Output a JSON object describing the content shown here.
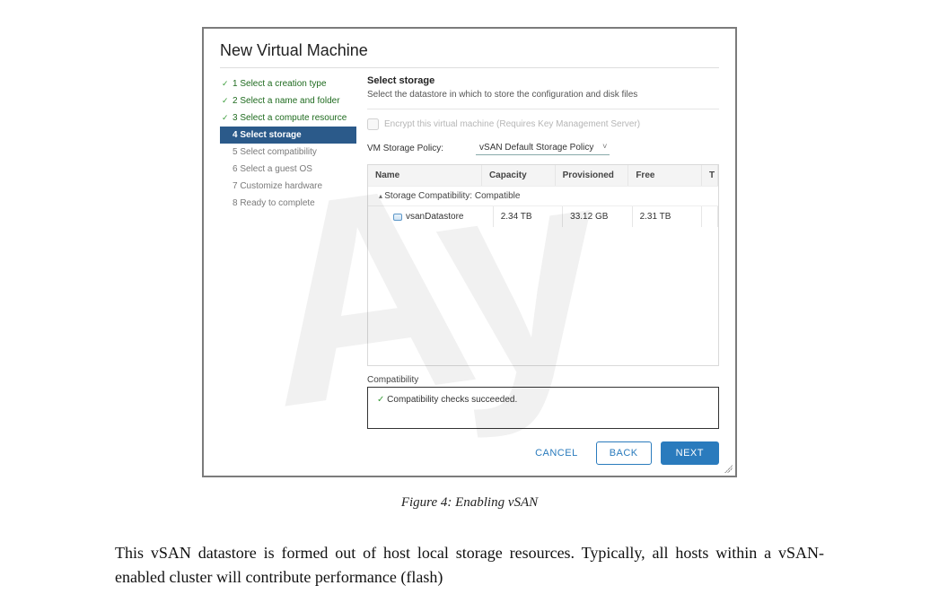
{
  "dialog": {
    "title": "New Virtual Machine",
    "steps": [
      {
        "label": "1 Select a creation type",
        "state": "done"
      },
      {
        "label": "2 Select a name and folder",
        "state": "done"
      },
      {
        "label": "3 Select a compute resource",
        "state": "done"
      },
      {
        "label": "4 Select storage",
        "state": "current"
      },
      {
        "label": "5 Select compatibility",
        "state": "pending"
      },
      {
        "label": "6 Select a guest OS",
        "state": "pending"
      },
      {
        "label": "7 Customize hardware",
        "state": "pending"
      },
      {
        "label": "8 Ready to complete",
        "state": "pending"
      }
    ],
    "pane": {
      "title": "Select storage",
      "subtitle": "Select the datastore in which to store the configuration and disk files",
      "encrypt_label": "Encrypt this virtual machine (Requires Key Management Server)",
      "policy_label": "VM Storage Policy:",
      "policy_value": "vSAN Default Storage Policy",
      "columns": {
        "name": "Name",
        "capacity": "Capacity",
        "provisioned": "Provisioned",
        "free": "Free",
        "t": "T"
      },
      "group_label": "Storage Compatibility: Compatible",
      "row": {
        "name": "vsanDatastore",
        "capacity": "2.34 TB",
        "provisioned": "33.12 GB",
        "free": "2.31 TB"
      },
      "compat_heading": "Compatibility",
      "compat_msg": "Compatibility checks succeeded."
    },
    "actions": {
      "cancel": "CANCEL",
      "back": "BACK",
      "next": "NEXT"
    }
  },
  "figure": {
    "caption": "Figure 4: Enabling vSAN"
  },
  "body": {
    "paragraph": "This vSAN datastore is formed out of host local storage resources. Typically, all hosts within a vSAN-enabled cluster will contribute performance (flash)"
  }
}
